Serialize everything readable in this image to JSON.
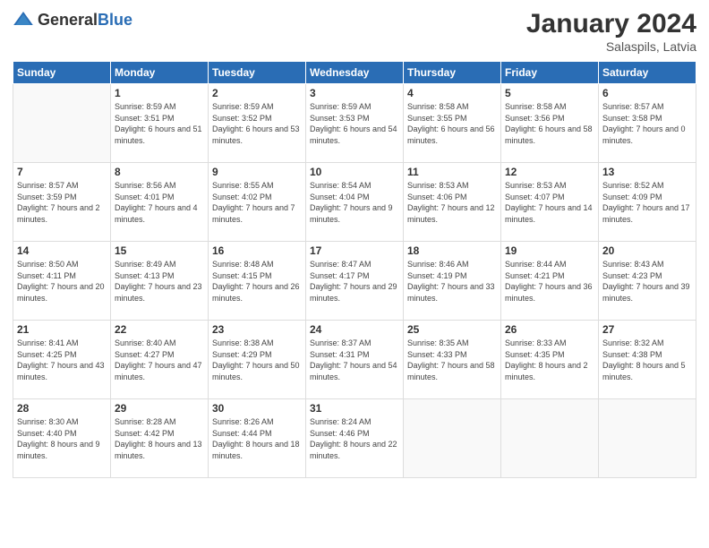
{
  "header": {
    "logo_general": "General",
    "logo_blue": "Blue",
    "month_year": "January 2024",
    "location": "Salaspils, Latvia"
  },
  "days_of_week": [
    "Sunday",
    "Monday",
    "Tuesday",
    "Wednesday",
    "Thursday",
    "Friday",
    "Saturday"
  ],
  "weeks": [
    [
      {
        "day": "",
        "empty": true
      },
      {
        "day": "1",
        "sunrise": "8:59 AM",
        "sunset": "3:51 PM",
        "daylight": "6 hours and 51 minutes."
      },
      {
        "day": "2",
        "sunrise": "8:59 AM",
        "sunset": "3:52 PM",
        "daylight": "6 hours and 53 minutes."
      },
      {
        "day": "3",
        "sunrise": "8:59 AM",
        "sunset": "3:53 PM",
        "daylight": "6 hours and 54 minutes."
      },
      {
        "day": "4",
        "sunrise": "8:58 AM",
        "sunset": "3:55 PM",
        "daylight": "6 hours and 56 minutes."
      },
      {
        "day": "5",
        "sunrise": "8:58 AM",
        "sunset": "3:56 PM",
        "daylight": "6 hours and 58 minutes."
      },
      {
        "day": "6",
        "sunrise": "8:57 AM",
        "sunset": "3:58 PM",
        "daylight": "7 hours and 0 minutes."
      }
    ],
    [
      {
        "day": "7",
        "sunrise": "8:57 AM",
        "sunset": "3:59 PM",
        "daylight": "7 hours and 2 minutes."
      },
      {
        "day": "8",
        "sunrise": "8:56 AM",
        "sunset": "4:01 PM",
        "daylight": "7 hours and 4 minutes."
      },
      {
        "day": "9",
        "sunrise": "8:55 AM",
        "sunset": "4:02 PM",
        "daylight": "7 hours and 7 minutes."
      },
      {
        "day": "10",
        "sunrise": "8:54 AM",
        "sunset": "4:04 PM",
        "daylight": "7 hours and 9 minutes."
      },
      {
        "day": "11",
        "sunrise": "8:53 AM",
        "sunset": "4:06 PM",
        "daylight": "7 hours and 12 minutes."
      },
      {
        "day": "12",
        "sunrise": "8:53 AM",
        "sunset": "4:07 PM",
        "daylight": "7 hours and 14 minutes."
      },
      {
        "day": "13",
        "sunrise": "8:52 AM",
        "sunset": "4:09 PM",
        "daylight": "7 hours and 17 minutes."
      }
    ],
    [
      {
        "day": "14",
        "sunrise": "8:50 AM",
        "sunset": "4:11 PM",
        "daylight": "7 hours and 20 minutes."
      },
      {
        "day": "15",
        "sunrise": "8:49 AM",
        "sunset": "4:13 PM",
        "daylight": "7 hours and 23 minutes."
      },
      {
        "day": "16",
        "sunrise": "8:48 AM",
        "sunset": "4:15 PM",
        "daylight": "7 hours and 26 minutes."
      },
      {
        "day": "17",
        "sunrise": "8:47 AM",
        "sunset": "4:17 PM",
        "daylight": "7 hours and 29 minutes."
      },
      {
        "day": "18",
        "sunrise": "8:46 AM",
        "sunset": "4:19 PM",
        "daylight": "7 hours and 33 minutes."
      },
      {
        "day": "19",
        "sunrise": "8:44 AM",
        "sunset": "4:21 PM",
        "daylight": "7 hours and 36 minutes."
      },
      {
        "day": "20",
        "sunrise": "8:43 AM",
        "sunset": "4:23 PM",
        "daylight": "7 hours and 39 minutes."
      }
    ],
    [
      {
        "day": "21",
        "sunrise": "8:41 AM",
        "sunset": "4:25 PM",
        "daylight": "7 hours and 43 minutes."
      },
      {
        "day": "22",
        "sunrise": "8:40 AM",
        "sunset": "4:27 PM",
        "daylight": "7 hours and 47 minutes."
      },
      {
        "day": "23",
        "sunrise": "8:38 AM",
        "sunset": "4:29 PM",
        "daylight": "7 hours and 50 minutes."
      },
      {
        "day": "24",
        "sunrise": "8:37 AM",
        "sunset": "4:31 PM",
        "daylight": "7 hours and 54 minutes."
      },
      {
        "day": "25",
        "sunrise": "8:35 AM",
        "sunset": "4:33 PM",
        "daylight": "7 hours and 58 minutes."
      },
      {
        "day": "26",
        "sunrise": "8:33 AM",
        "sunset": "4:35 PM",
        "daylight": "8 hours and 2 minutes."
      },
      {
        "day": "27",
        "sunrise": "8:32 AM",
        "sunset": "4:38 PM",
        "daylight": "8 hours and 5 minutes."
      }
    ],
    [
      {
        "day": "28",
        "sunrise": "8:30 AM",
        "sunset": "4:40 PM",
        "daylight": "8 hours and 9 minutes."
      },
      {
        "day": "29",
        "sunrise": "8:28 AM",
        "sunset": "4:42 PM",
        "daylight": "8 hours and 13 minutes."
      },
      {
        "day": "30",
        "sunrise": "8:26 AM",
        "sunset": "4:44 PM",
        "daylight": "8 hours and 18 minutes."
      },
      {
        "day": "31",
        "sunrise": "8:24 AM",
        "sunset": "4:46 PM",
        "daylight": "8 hours and 22 minutes."
      },
      {
        "day": "",
        "empty": true
      },
      {
        "day": "",
        "empty": true
      },
      {
        "day": "",
        "empty": true
      }
    ]
  ]
}
